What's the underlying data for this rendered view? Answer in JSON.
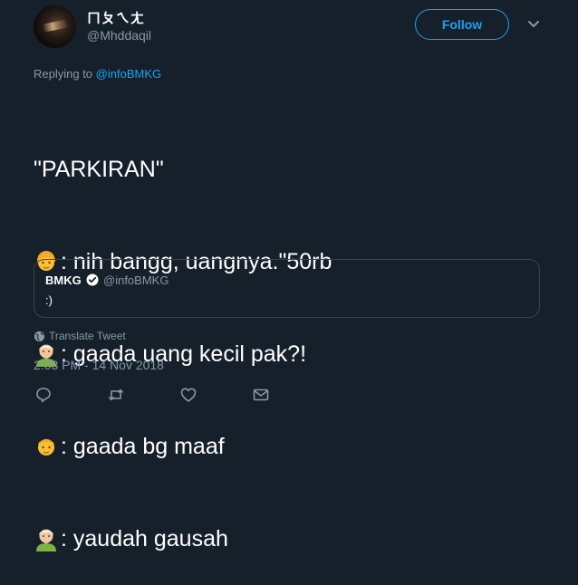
{
  "user": {
    "display_name": "ㄇㄆㄟㄤ",
    "handle": "@Mhddaqil",
    "follow_label": "Follow"
  },
  "reply": {
    "prefix": "Replying to ",
    "mention": "@infoBMKG"
  },
  "tweet": {
    "lines": [
      {
        "emoji": "",
        "text": "\"PARKIRAN\""
      },
      {
        "emoji": "person-blond-emoji",
        "text": ": nih bangg, uangnya.\"50rb"
      },
      {
        "emoji": "old-man-emoji",
        "text": ": gaada uang kecil pak?!"
      },
      {
        "emoji": "person-blond-emoji",
        "text": ": gaada bg maaf"
      },
      {
        "emoji": "old-man-emoji",
        "text": ": yaudah gausah"
      }
    ]
  },
  "quote": {
    "name": "BMKG",
    "handle": "@infoBMKG",
    "text": ":)"
  },
  "translate_label": "Translate Tweet",
  "timestamp": "2:03 PM - 14 Nov 2018",
  "actions": [
    "reply-icon",
    "retweet-icon",
    "like-icon",
    "message-icon"
  ],
  "colors": {
    "background": "#15202b",
    "accent": "#1da1f2",
    "muted": "#8899a6",
    "border": "#38444d"
  }
}
